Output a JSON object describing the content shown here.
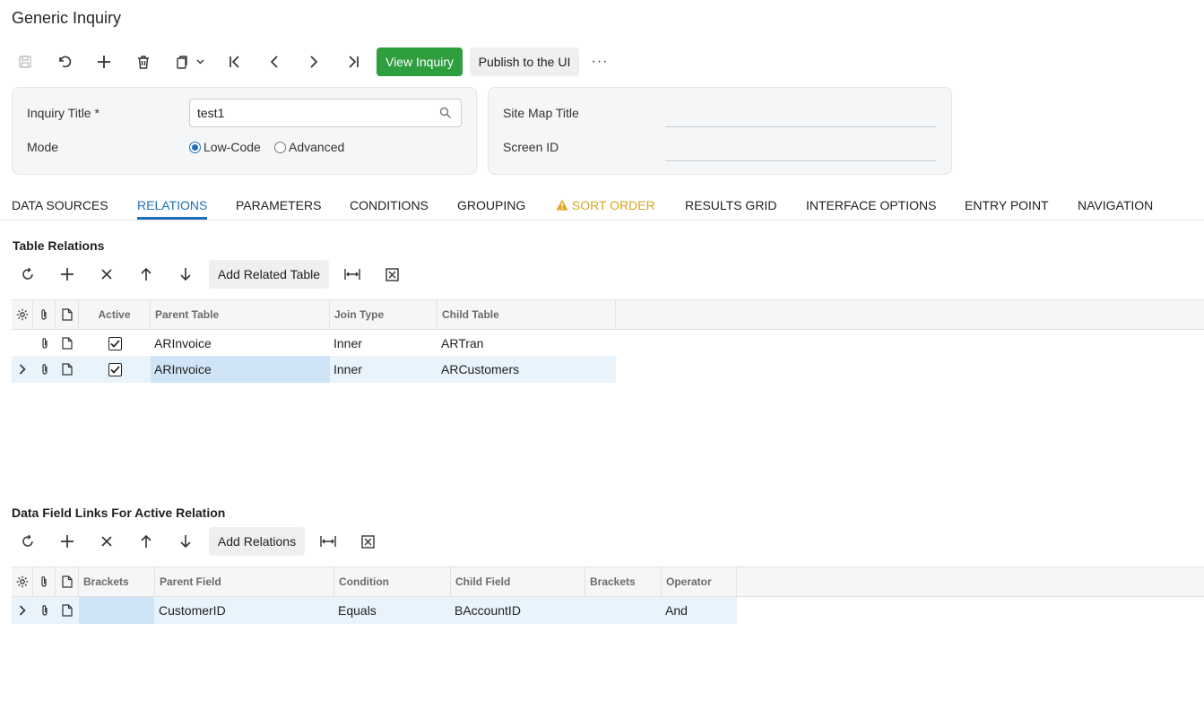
{
  "page_title": "Generic Inquiry",
  "toolbar": {
    "view_inquiry": "View Inquiry",
    "publish": "Publish to the UI",
    "more": "···"
  },
  "form": {
    "inquiry_title_label": "Inquiry Title",
    "required_mark": "*",
    "inquiry_title_value": "test1",
    "mode_label": "Mode",
    "mode_low_code": "Low-Code",
    "mode_advanced": "Advanced",
    "site_map_title_label": "Site Map Title",
    "site_map_title_value": "",
    "screen_id_label": "Screen ID",
    "screen_id_value": ""
  },
  "tabs": [
    {
      "label": "DATA SOURCES"
    },
    {
      "label": "RELATIONS"
    },
    {
      "label": "PARAMETERS"
    },
    {
      "label": "CONDITIONS"
    },
    {
      "label": "GROUPING"
    },
    {
      "label": "SORT ORDER"
    },
    {
      "label": "RESULTS GRID"
    },
    {
      "label": "INTERFACE OPTIONS"
    },
    {
      "label": "ENTRY POINT"
    },
    {
      "label": "NAVIGATION"
    }
  ],
  "active_tab": "RELATIONS",
  "table_relations": {
    "title": "Table Relations",
    "add_button": "Add Related Table",
    "columns": {
      "active": "Active",
      "parent_table": "Parent Table",
      "join_type": "Join Type",
      "child_table": "Child Table"
    },
    "rows": [
      {
        "active": true,
        "parent_table": "ARInvoice",
        "join_type": "Inner",
        "child_table": "ARTran"
      },
      {
        "active": true,
        "parent_table": "ARInvoice",
        "join_type": "Inner",
        "child_table": "ARCustomers"
      }
    ]
  },
  "field_links": {
    "title": "Data Field Links For Active Relation",
    "add_button": "Add Relations",
    "columns": {
      "brackets_open": "Brackets",
      "parent_field": "Parent Field",
      "condition": "Condition",
      "child_field": "Child Field",
      "brackets_close": "Brackets",
      "operator": "Operator"
    },
    "rows": [
      {
        "brackets_open": "",
        "parent_field": "CustomerID",
        "condition": "Equals",
        "child_field": "BAccountID",
        "brackets_close": "",
        "operator": "And"
      }
    ]
  },
  "colors": {
    "accent": "#1f6fb8",
    "primary_button": "#2e9e3f",
    "warning": "#d9a520",
    "selected_row": "#e8f3fb"
  }
}
